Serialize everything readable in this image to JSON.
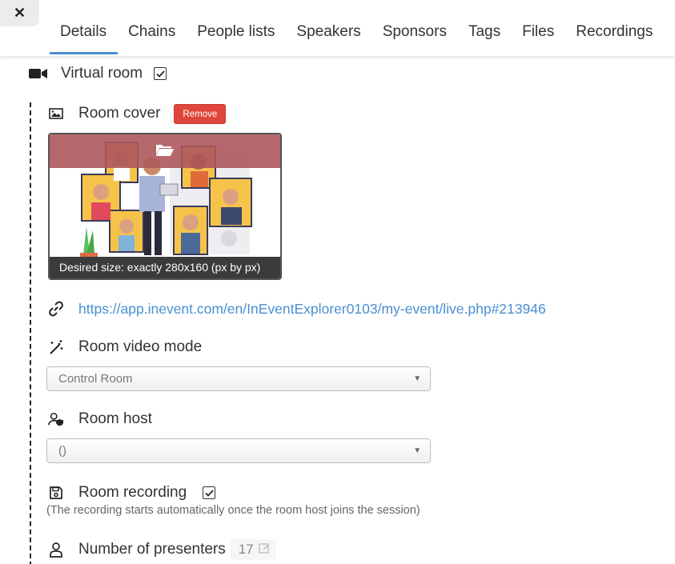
{
  "tabs": [
    {
      "label": "Details",
      "active": true
    },
    {
      "label": "Chains",
      "active": false
    },
    {
      "label": "People lists",
      "active": false
    },
    {
      "label": "Speakers",
      "active": false
    },
    {
      "label": "Sponsors",
      "active": false
    },
    {
      "label": "Tags",
      "active": false
    },
    {
      "label": "Files",
      "active": false
    },
    {
      "label": "Recordings",
      "active": false
    }
  ],
  "close": {
    "glyph": "✕"
  },
  "virtual_room": {
    "label": "Virtual room",
    "checked": true,
    "icon": "video-camera-icon"
  },
  "room_cover": {
    "label": "Room cover",
    "remove_label": "Remove",
    "caption": "Desired size: exactly 280x160 (px by px)",
    "icon": "image-icon"
  },
  "room_link": {
    "url": "https://app.inevent.com/en/InEventExplorer0103/my-event/live.php#213946",
    "icon": "link-icon"
  },
  "video_mode": {
    "label": "Room video mode",
    "value": "Control Room",
    "icon": "magic-wand-icon"
  },
  "room_host": {
    "label": "Room host",
    "value": "()",
    "icon": "user-shield-icon"
  },
  "room_recording": {
    "label": "Room recording",
    "checked": true,
    "note": "(The recording starts automatically once the room host joins the session)",
    "icon": "save-icon"
  },
  "presenters": {
    "label": "Number of presenters",
    "value": "17",
    "icon": "user-icon"
  },
  "colors": {
    "accent": "#4a8fd1",
    "danger": "#e0463c",
    "overlay": "#ad585c"
  }
}
